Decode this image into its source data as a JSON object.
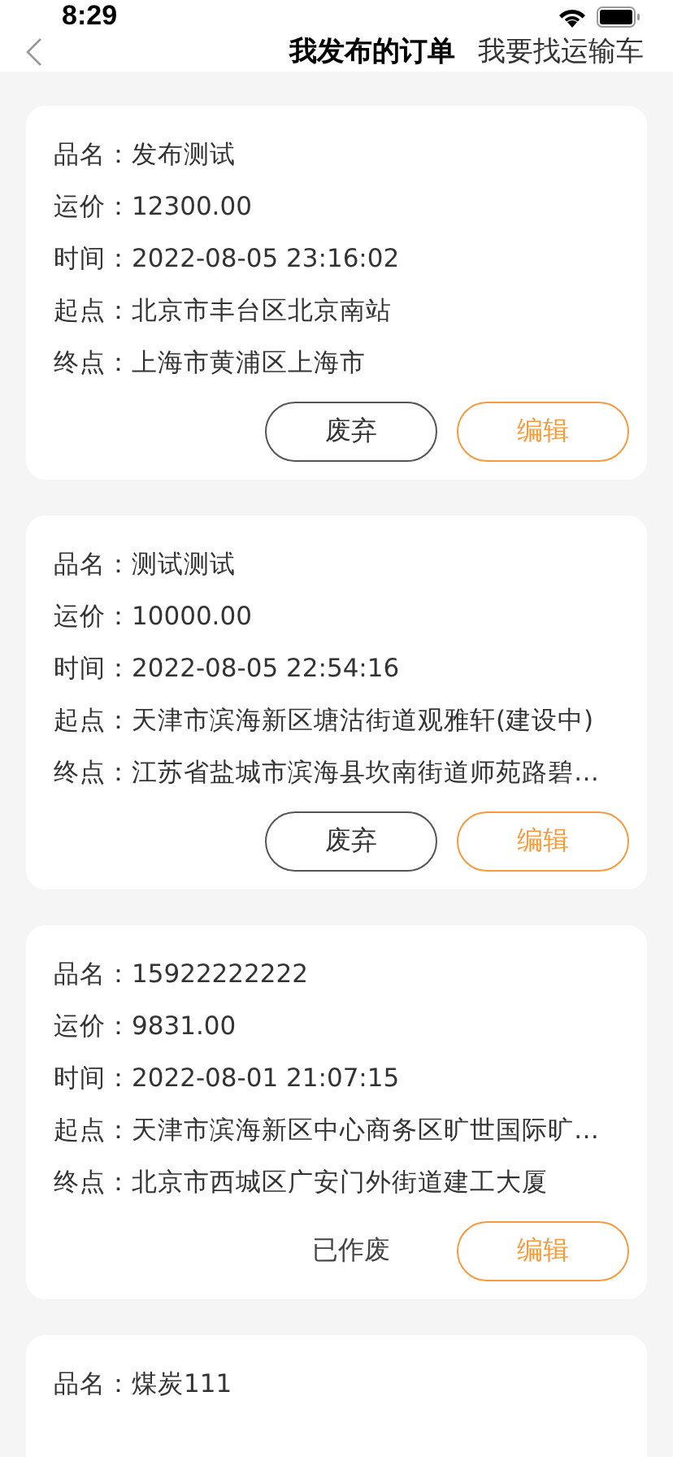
{
  "status_bar": {
    "time": "8:29"
  },
  "nav": {
    "tabs": [
      {
        "label": "我发布的订单",
        "selected": true
      },
      {
        "label": "我要找运输车",
        "selected": false
      }
    ]
  },
  "orders": [
    {
      "fields": [
        {
          "label": "品名：",
          "value": "发布测试"
        },
        {
          "label": "运价：",
          "value": "12300.00"
        },
        {
          "label": "时间：",
          "value": "2022-08-05 23:16:02"
        },
        {
          "label": "起点：",
          "value": "北京市丰台区北京南站"
        },
        {
          "label": "终点：",
          "value": "上海市黄浦区上海市"
        }
      ],
      "actions": [
        {
          "kind": "button",
          "label": "废弃"
        },
        {
          "kind": "primary",
          "label": "编辑"
        }
      ]
    },
    {
      "fields": [
        {
          "label": "品名：",
          "value": "测试测试"
        },
        {
          "label": "运价：",
          "value": "10000.00"
        },
        {
          "label": "时间：",
          "value": "2022-08-05 22:54:16"
        },
        {
          "label": "起点：",
          "value": "天津市滨海新区塘沽街道观雅轩(建设中)"
        },
        {
          "label": "终点：",
          "value": "江苏省盐城市滨海县坎南街道师苑路碧…"
        }
      ],
      "actions": [
        {
          "kind": "button",
          "label": "废弃"
        },
        {
          "kind": "primary",
          "label": "编辑"
        }
      ]
    },
    {
      "fields": [
        {
          "label": "品名：",
          "value": "15922222222"
        },
        {
          "label": "运价：",
          "value": "9831.00"
        },
        {
          "label": "时间：",
          "value": "2022-08-01 21:07:15"
        },
        {
          "label": "起点：",
          "value": "天津市滨海新区中心商务区旷世国际旷…"
        },
        {
          "label": "终点：",
          "value": "北京市西城区广安门外街道建工大厦"
        }
      ],
      "actions": [
        {
          "kind": "status",
          "label": "已作废"
        },
        {
          "kind": "primary",
          "label": "编辑"
        }
      ]
    },
    {
      "fields": [
        {
          "label": "品名：",
          "value": "煤炭111"
        }
      ]
    }
  ]
}
